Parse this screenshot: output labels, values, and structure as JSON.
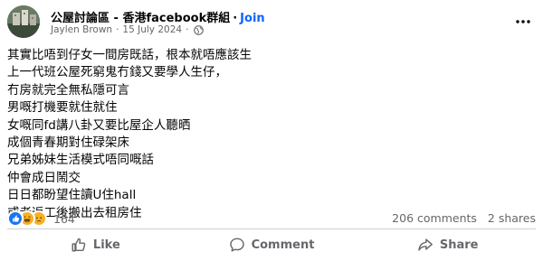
{
  "post": {
    "group_name": "公屋討論區 - 香港facebook群組",
    "separator": "·",
    "join_label": "Join",
    "author": "Jaylen Brown",
    "meta_separator": "·",
    "date": "15 July 2024",
    "visibility_icon": "globe-icon",
    "more_icon": "more-options-icon",
    "lines": [
      "其實比唔到仔女一間房既話，根本就唔應該生",
      "上一代班公屋死窮鬼冇錢又要學人生仔，",
      "冇房就完全無私隱可言",
      "男嘅打機要就住就住",
      "女嘅同fd講八卦又要比屋企人聽晒",
      "成個青春期對住碌架床",
      "兄弟姊妹生活模式唔同嘅話",
      "仲會成日鬧交",
      "日日都盼望住讀U住hall",
      "或者返工後搬出去租房住"
    ]
  },
  "stats": {
    "reactions": [
      "like",
      "haha",
      "sad"
    ],
    "reaction_count": "164",
    "comments": "206 comments",
    "shares": "2 shares"
  },
  "actions": {
    "like": "Like",
    "comment": "Comment",
    "share": "Share"
  },
  "colors": {
    "accent": "#0866ff",
    "secondary_text": "#65676b",
    "like_reaction": "#1877f2",
    "haha_reaction": "#f7b125"
  }
}
